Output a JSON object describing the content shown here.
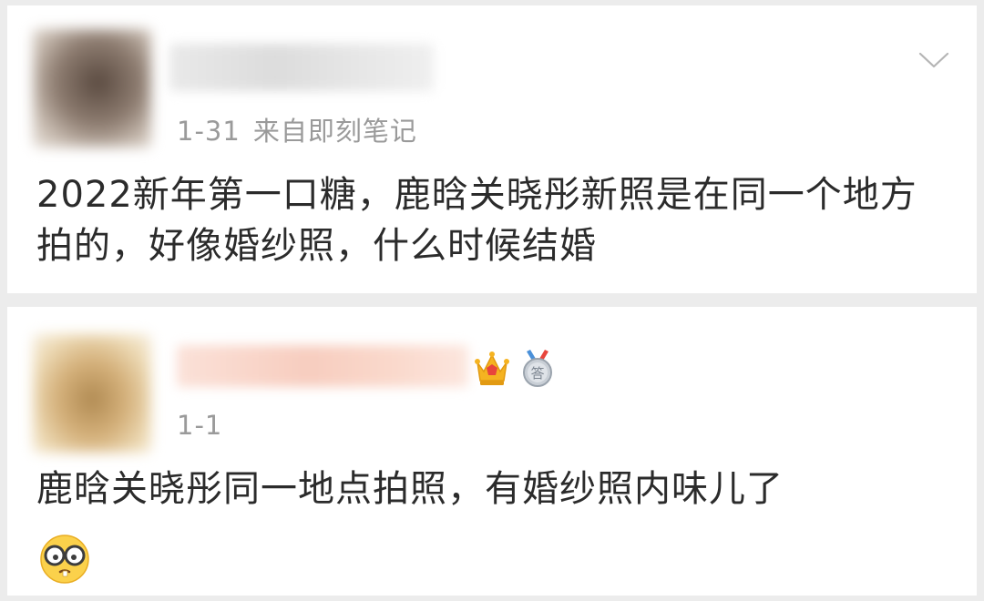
{
  "comments": [
    {
      "date": "1-31",
      "source": "来自即刻笔记",
      "text": "2022新年第一口糖，鹿晗关晓彤新照是在同一个地方拍的，好像婚纱照，什么时候结婚"
    },
    {
      "date": "1-1",
      "text": "鹿晗关晓彤同一地点拍照，有婚纱照内味儿了",
      "badges": [
        "crown-icon",
        "medal-icon"
      ],
      "emoji": "nerd-glasses-emoji",
      "medal_char": "答"
    }
  ],
  "colors": {
    "background": "#ececec",
    "card": "#ffffff",
    "text": "#2b2b2b",
    "meta": "#9a9a9a"
  }
}
